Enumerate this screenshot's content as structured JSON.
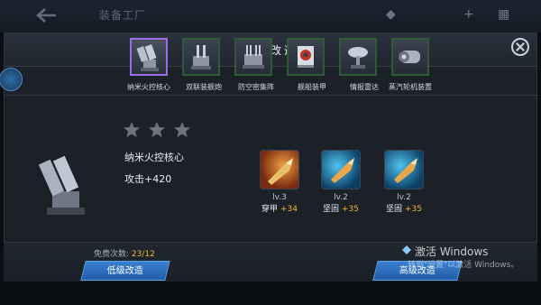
{
  "top_bar": {
    "title": "装备工厂"
  },
  "panel": {
    "title": "装备改造"
  },
  "equipment": [
    {
      "label": "纳米火控核心",
      "icon": "turret-icon"
    },
    {
      "label": "双联装舰炮",
      "icon": "twin-gun-icon"
    },
    {
      "label": "防空密集阵",
      "icon": "ciws-icon"
    },
    {
      "label": "舰船装甲",
      "icon": "armor-plate-icon"
    },
    {
      "label": "情报雷达",
      "icon": "radar-dish-icon"
    },
    {
      "label": "蒸汽轮机装置",
      "icon": "turbine-icon"
    }
  ],
  "selected": {
    "name": "纳米火控核心",
    "stat": "攻击+420",
    "stars_total": 3,
    "stars_filled": 0
  },
  "upgrades": [
    {
      "level": "lv.3",
      "effect": "穿甲",
      "bonus": "+34",
      "icon": "armor-pierce-shell-icon",
      "color": "#c8561d"
    },
    {
      "level": "lv.2",
      "effect": "坚固",
      "bonus": "+35",
      "icon": "durable-shell-icon",
      "color": "#1d7fb3"
    },
    {
      "level": "lv.2",
      "effect": "坚固",
      "bonus": "+35",
      "icon": "durable-shell-icon",
      "color": "#1d7fb3"
    }
  ],
  "free_attempts": {
    "label": "免费次数:",
    "count": "23/12"
  },
  "buttons": {
    "low": "低级改造",
    "high": "高级改造"
  },
  "watermark": {
    "line1": "激活 Windows",
    "line2": "转到\"设置\"以激活 Windows。"
  },
  "colors": {
    "accent_gold": "#f0b43c",
    "button_blue": "#2b6fc0",
    "selected_border": "#9a6ee6",
    "slot_border": "#2f5a37"
  }
}
